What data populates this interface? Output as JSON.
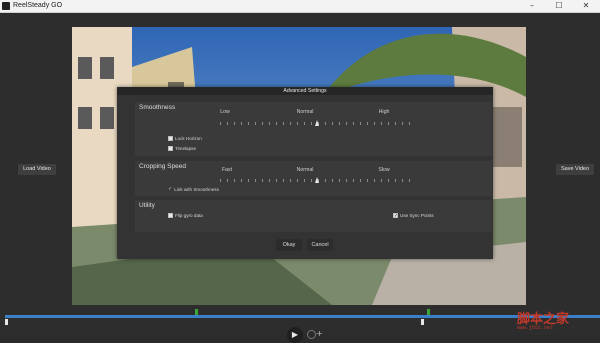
{
  "window": {
    "title": "ReelSteady GO",
    "controls": [
      "–",
      "☐",
      "✕"
    ]
  },
  "video_controls": {
    "load_label": "Load Video",
    "save_label": "Save Video"
  },
  "dialog": {
    "title": "Advanced Settings",
    "smoothness": {
      "title": "Smoothness",
      "levels": [
        "Low",
        "Normal",
        "High"
      ],
      "value_pct": 50,
      "lock_horizon_label": "Lock Horizon",
      "lock_horizon_checked": false,
      "timelapse_label": "Timelapse",
      "timelapse_checked": false
    },
    "cropping": {
      "title": "Cropping Speed",
      "levels": [
        "Fast",
        "Normal",
        "Slow"
      ],
      "value_pct": 50,
      "link_label": "Link with Smoothness",
      "link_checked": true
    },
    "utility": {
      "title": "Utility",
      "flip_gyro_label": "Flip gyro data",
      "flip_gyro_checked": false,
      "sync_points_label": "Use Sync Points",
      "sync_points_checked": true
    },
    "ok_label": "Okay",
    "cancel_label": "Cancel"
  },
  "timeline": {
    "accent": "#3b7fc8",
    "sync_marker_color": "#3ea53e"
  },
  "watermark": {
    "line1": "脚本之家",
    "line2": "www.jb51.net"
  }
}
